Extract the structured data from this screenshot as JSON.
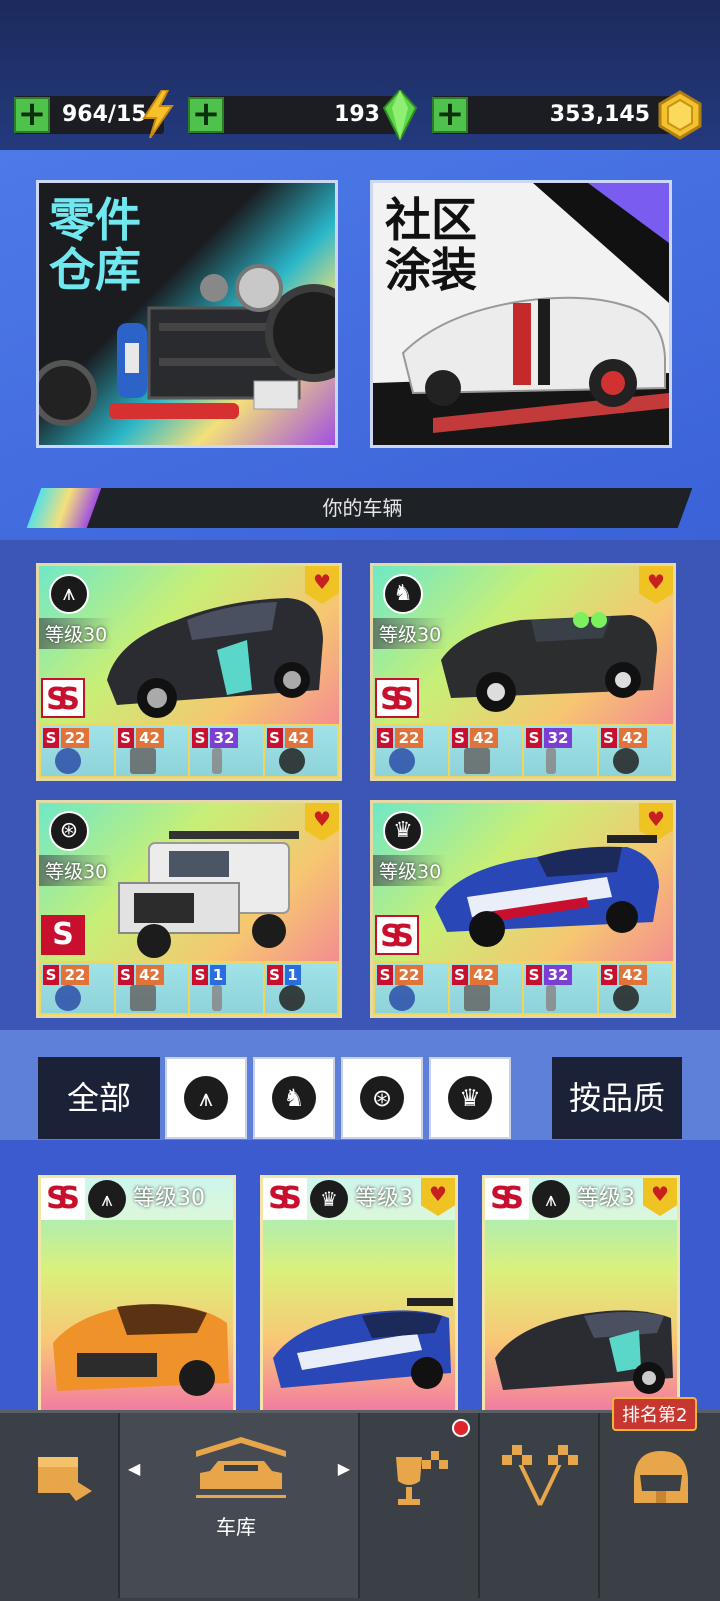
{
  "resources": {
    "energy": {
      "value": "964/15",
      "icon": "lightning-icon"
    },
    "gems": {
      "value": "193",
      "icon": "gem-icon"
    },
    "coins": {
      "value": "353,145",
      "icon": "coin-icon"
    }
  },
  "shop": {
    "parts": {
      "title_line1": "零件",
      "title_line2": "仓库"
    },
    "livery": {
      "title_line1": "社区",
      "title_line2": "涂装"
    }
  },
  "section_title": "你的车辆",
  "garage": [
    {
      "level": "等级30",
      "class_icon": "road-icon",
      "grade": "SS",
      "parts": [
        [
          "S",
          "2",
          "2",
          "orange"
        ],
        [
          "S",
          "4",
          "2",
          "orange"
        ],
        [
          "S",
          "3",
          "2",
          "purple"
        ],
        [
          "S",
          "4",
          "2",
          "orange"
        ]
      ]
    },
    {
      "level": "等级30",
      "class_icon": "horse-icon",
      "grade": "SS",
      "parts": [
        [
          "S",
          "2",
          "2",
          "orange"
        ],
        [
          "S",
          "4",
          "2",
          "orange"
        ],
        [
          "S",
          "3",
          "2",
          "purple"
        ],
        [
          "S",
          "4",
          "2",
          "orange"
        ]
      ]
    },
    {
      "level": "等级30",
      "class_icon": "wheel-icon",
      "grade": "S",
      "parts": [
        [
          "S",
          "2",
          "2",
          "orange"
        ],
        [
          "S",
          "4",
          "2",
          "orange"
        ],
        [
          "S",
          "1",
          "",
          "blue"
        ],
        [
          "S",
          "1",
          "",
          "blue"
        ]
      ]
    },
    {
      "level": "等级30",
      "class_icon": "crown-icon",
      "grade": "SS",
      "parts": [
        [
          "S",
          "2",
          "2",
          "orange"
        ],
        [
          "S",
          "4",
          "2",
          "orange"
        ],
        [
          "S",
          "3",
          "2",
          "purple"
        ],
        [
          "S",
          "4",
          "2",
          "orange"
        ]
      ]
    }
  ],
  "filters": {
    "all_label": "全部",
    "quality_label": "按品质"
  },
  "list": [
    {
      "grade": "SS",
      "level": "等级30"
    },
    {
      "grade": "SS",
      "level": "等级3"
    },
    {
      "grade": "SS",
      "level": "等级3"
    }
  ],
  "nav": {
    "garage_label": "车库",
    "rank_badge": "排名第2"
  },
  "colors": {
    "accent_green": "#4ec24a",
    "grade_red": "#c8102e",
    "nav_gold": "#e7a64a"
  }
}
